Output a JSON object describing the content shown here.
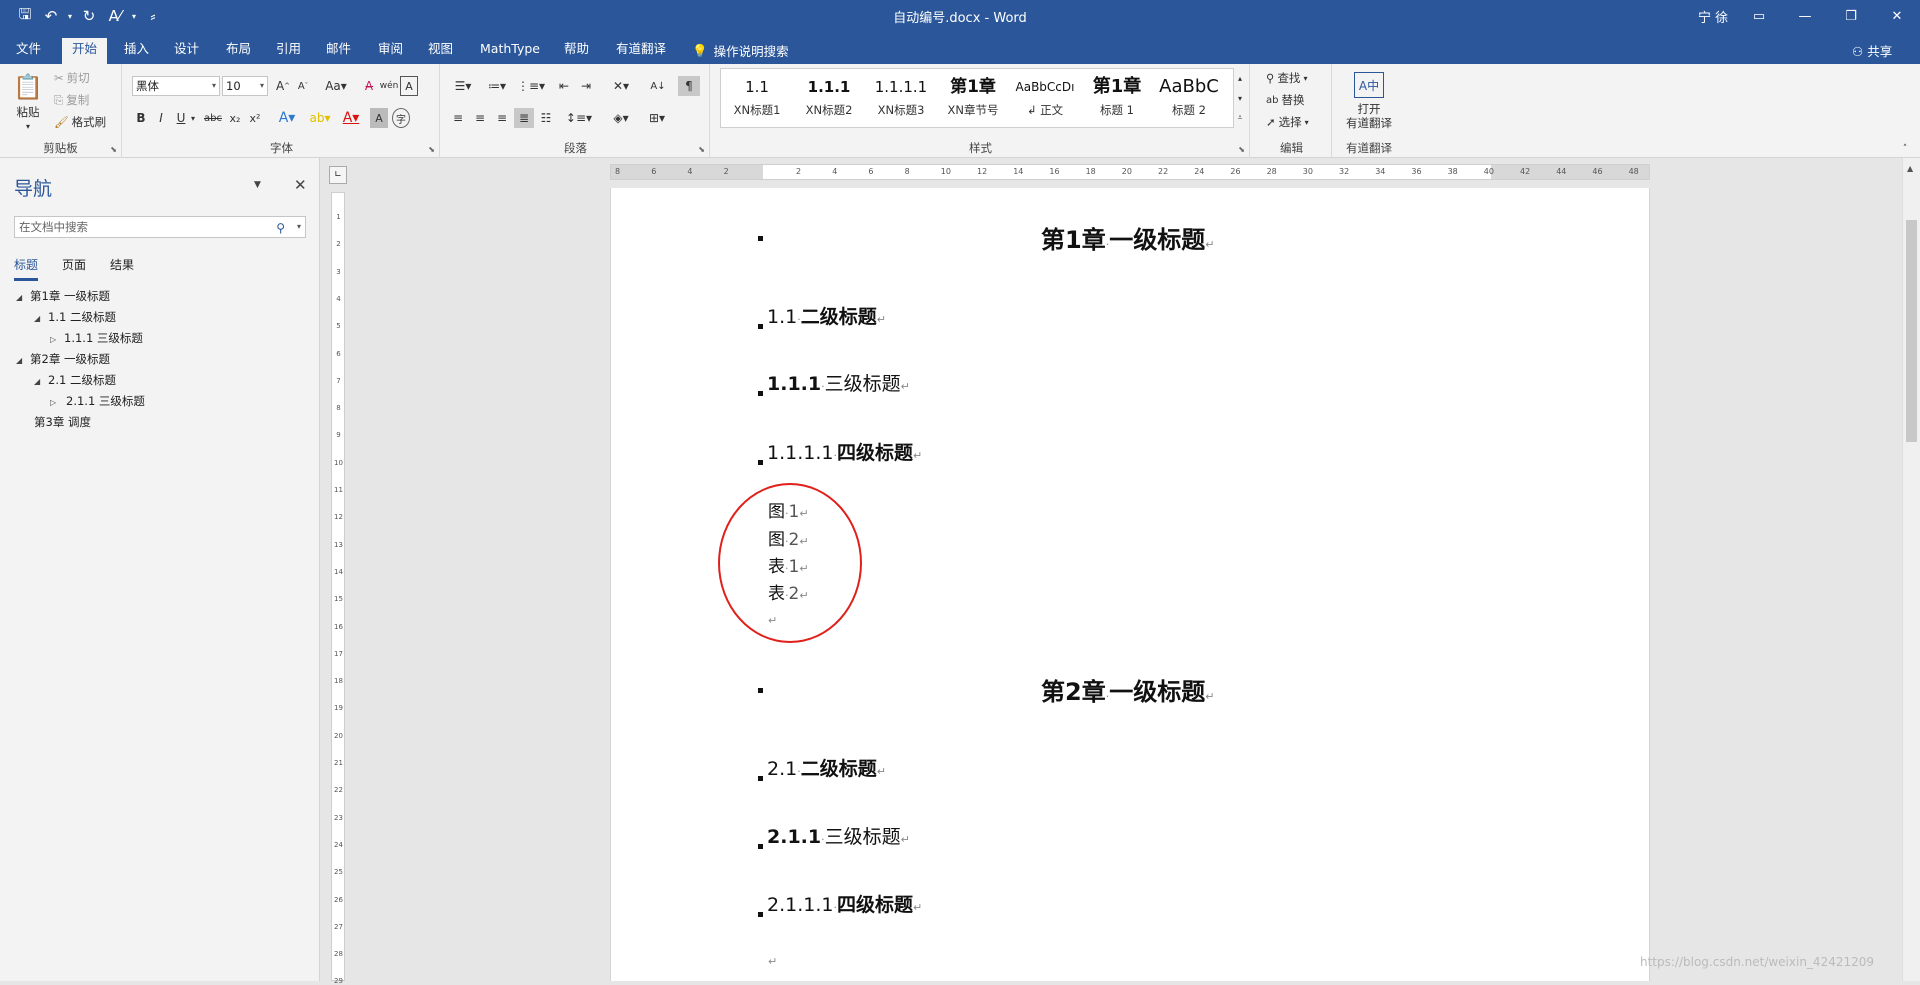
{
  "window": {
    "title": "自动编号.docx  -  Word",
    "user": "宁 徐",
    "controls": [
      "ribbon-display-icon",
      "minimize-icon",
      "restore-icon",
      "close-icon"
    ]
  },
  "qat": {
    "save": "🖫",
    "undo": "↶",
    "redo": "↻",
    "spell": "A⁄",
    "customize": "⸗"
  },
  "tabs": [
    "文件",
    "开始",
    "插入",
    "设计",
    "布局",
    "引用",
    "邮件",
    "审阅",
    "视图",
    "MathType",
    "帮助",
    "有道翻译"
  ],
  "active_tab": "开始",
  "tell_me": "操作说明搜索",
  "share": "共享",
  "ribbon": {
    "clipboard": {
      "label": "剪贴板",
      "paste": "粘贴",
      "cut": "剪切",
      "copy": "复制",
      "format_painter": "格式刷"
    },
    "font": {
      "label": "字体",
      "font_name": "黑体",
      "font_size": "10"
    },
    "paragraph": {
      "label": "段落"
    },
    "styles": {
      "label": "样式",
      "items": [
        {
          "sample": "1.1",
          "name": "XN标题1"
        },
        {
          "sample": "1.1.1",
          "name": "XN标题2"
        },
        {
          "sample": "1.1.1.1",
          "name": "XN标题3"
        },
        {
          "sample": "第1章",
          "name": "XN章节号"
        },
        {
          "sample": "AaBbCcDı",
          "name": "↲ 正文"
        },
        {
          "sample": "第1章",
          "name": "标题 1"
        },
        {
          "sample": "AaBbC",
          "name": "标题 2"
        }
      ]
    },
    "editing": {
      "label": "编辑",
      "find": "查找",
      "replace": "替换",
      "select": "选择"
    },
    "youdao": {
      "label": "有道翻译",
      "open_line1": "打开",
      "open_line2": "有道翻译"
    }
  },
  "nav": {
    "title": "导航",
    "search_placeholder": "在文档中搜索",
    "tabs": [
      "标题",
      "页面",
      "结果"
    ],
    "items": [
      {
        "text": "第1章 一级标题",
        "level": 0,
        "expanded": true
      },
      {
        "text": "1.1 二级标题",
        "level": 1,
        "expanded": true
      },
      {
        "text": "1.1.1 三级标题",
        "level": 2,
        "expanded": false
      },
      {
        "text": "第2章 一级标题",
        "level": 0,
        "expanded": true
      },
      {
        "text": "2.1 二级标题",
        "level": 1,
        "expanded": true
      },
      {
        "text": "2.1.1 三级标题",
        "level": 2,
        "expanded": false,
        "selected": true
      },
      {
        "text": "第3章 调度",
        "level": 0,
        "expanded": null
      }
    ]
  },
  "document": {
    "ch1": {
      "num": "第1章",
      "text": "一级标题"
    },
    "s11": {
      "num": "1.1",
      "text": "二级标题"
    },
    "s111": {
      "num": "1.1.1",
      "text": "三级标题"
    },
    "s1111": {
      "num": "1.1.1.1",
      "text": "四级标题"
    },
    "captions": [
      {
        "label": "图",
        "num": "1"
      },
      {
        "label": "图",
        "num": "2"
      },
      {
        "label": "表",
        "num": "1"
      },
      {
        "label": "表",
        "num": "2"
      }
    ],
    "ch2": {
      "num": "第2章",
      "text": "一级标题"
    },
    "s21": {
      "num": "2.1",
      "text": "二级标题"
    },
    "s211": {
      "num": "2.1.1",
      "text": "三级标题"
    },
    "s2111": {
      "num": "2.1.1.1",
      "text": "四级标题"
    },
    "para_mark": "↵",
    "space_mark": "·"
  },
  "ruler_h": [
    "8",
    "6",
    "4",
    "2",
    "",
    "2",
    "4",
    "6",
    "8",
    "10",
    "12",
    "14",
    "16",
    "18",
    "20",
    "22",
    "24",
    "26",
    "28",
    "30",
    "32",
    "34",
    "36",
    "38",
    "40",
    "42",
    "44",
    "46",
    "48"
  ],
  "ruler_v": [
    "1",
    "2",
    "3",
    "4",
    "5",
    "6",
    "7",
    "8",
    "9",
    "10",
    "11",
    "12",
    "13",
    "14",
    "15",
    "16",
    "17",
    "18",
    "19",
    "20",
    "21",
    "22",
    "23",
    "24",
    "25",
    "26",
    "27",
    "28",
    "29"
  ],
  "watermark": "https://blog.csdn.net/weixin_42421209",
  "colors": {
    "brand": "#2b579a",
    "annotation": "#e0201a"
  }
}
